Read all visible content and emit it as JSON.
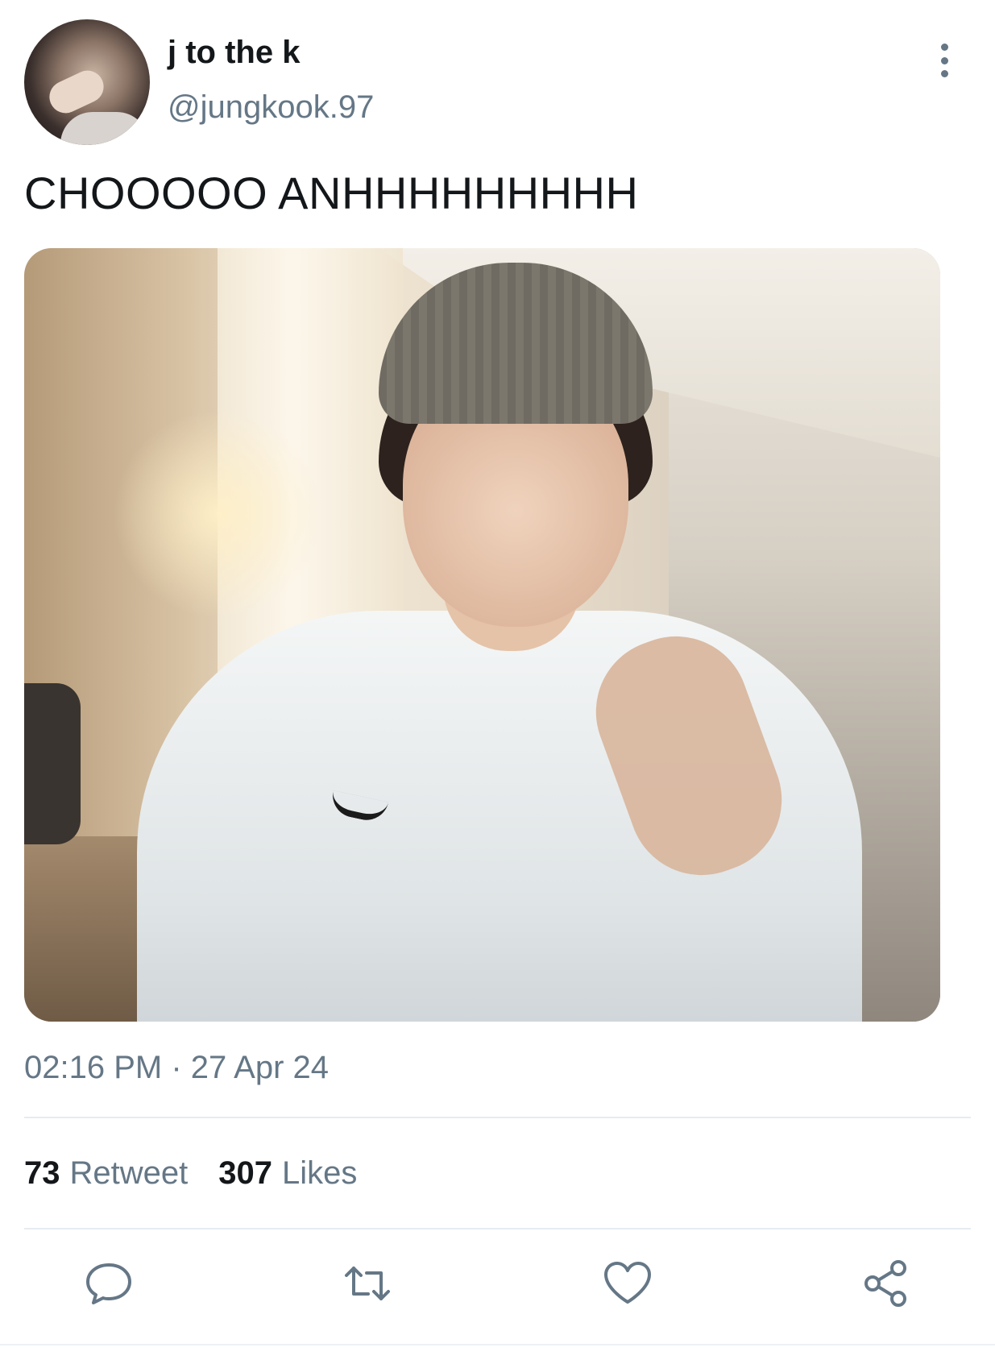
{
  "author": {
    "display_name": "j to the k",
    "handle": "@jungkook.97",
    "avatar_icon": "profile-photo"
  },
  "menu": {
    "icon": "more-vertical-icon"
  },
  "tweet": {
    "text": "CHOOOOO ANHHHHHHHHH",
    "media_icon": "photo",
    "timestamp": "02:16 PM · 27 Apr 24"
  },
  "stats": {
    "retweets_count": "73",
    "retweets_label": "Retweet",
    "likes_count": "307",
    "likes_label": "Likes"
  },
  "actions": [
    {
      "name": "reply",
      "icon": "speech-bubble-icon"
    },
    {
      "name": "retweet",
      "icon": "retweet-arrows-icon"
    },
    {
      "name": "like",
      "icon": "heart-icon"
    },
    {
      "name": "share",
      "icon": "share-nodes-icon"
    }
  ],
  "colors": {
    "primary_text": "#14171a",
    "secondary_text": "#657786",
    "divider": "#e6ecf0"
  }
}
